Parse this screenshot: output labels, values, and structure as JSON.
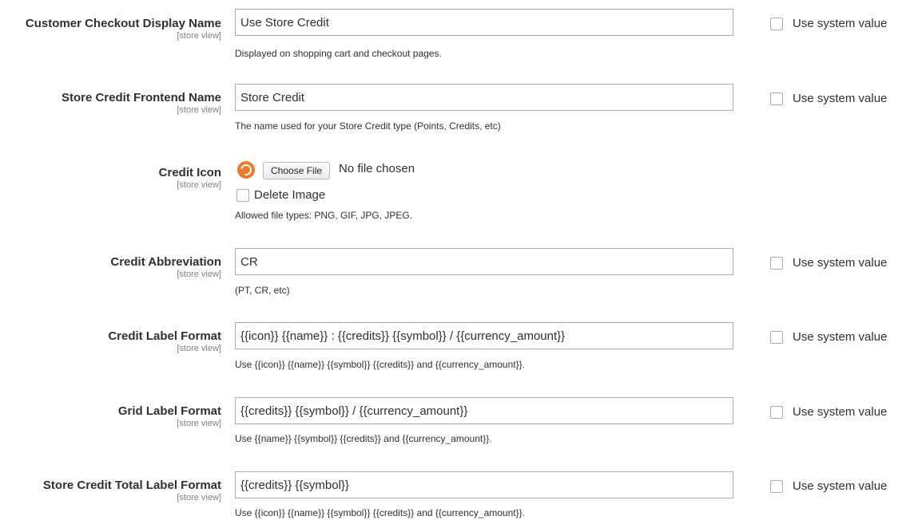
{
  "fields": [
    {
      "label": "Customer Checkout Display Name",
      "scope": "[store view]",
      "value": "Use Store Credit",
      "note": "Displayed on shopping cart and checkout pages.",
      "system_label": "Use system value"
    },
    {
      "label": "Store Credit Frontend Name",
      "scope": "[store view]",
      "value": "Store Credit",
      "note": "The name used for your Store Credit type (Points, Credits, etc)",
      "system_label": "Use system value"
    },
    {
      "label": "Credit Abbreviation",
      "scope": "[store view]",
      "value": "CR",
      "note": "(PT, CR, etc)",
      "system_label": "Use system value"
    },
    {
      "label": "Credit Label Format",
      "scope": "[store view]",
      "value": "{{icon}} {{name}} : {{credits}} {{symbol}} / {{currency_amount}}",
      "note": "Use {{icon}} {{name}} {{symbol}} {{credits}} and {{currency_amount}}.",
      "system_label": "Use system value"
    },
    {
      "label": "Grid Label Format",
      "scope": "[store view]",
      "value": "{{credits}} {{symbol}} / {{currency_amount}}",
      "note": "Use {{name}} {{symbol}} {{credits}} and {{currency_amount}}.",
      "system_label": "Use system value"
    },
    {
      "label": "Store Credit Total Label Format",
      "scope": "[store view]",
      "value": "{{credits}} {{symbol}}",
      "note": "Use {{icon}} {{name}} {{symbol}} {{credits}} and {{currency_amount}}.",
      "system_label": "Use system value"
    }
  ],
  "credit_icon": {
    "label": "Credit Icon",
    "scope": "[store view]",
    "choose_button": "Choose File",
    "file_status": "No file chosen",
    "delete_label": "Delete Image",
    "note": "Allowed file types: PNG, GIF, JPG, JPEG.",
    "thumb_icon": "store-credit-icon",
    "thumb_color": "#ee7a2c"
  }
}
